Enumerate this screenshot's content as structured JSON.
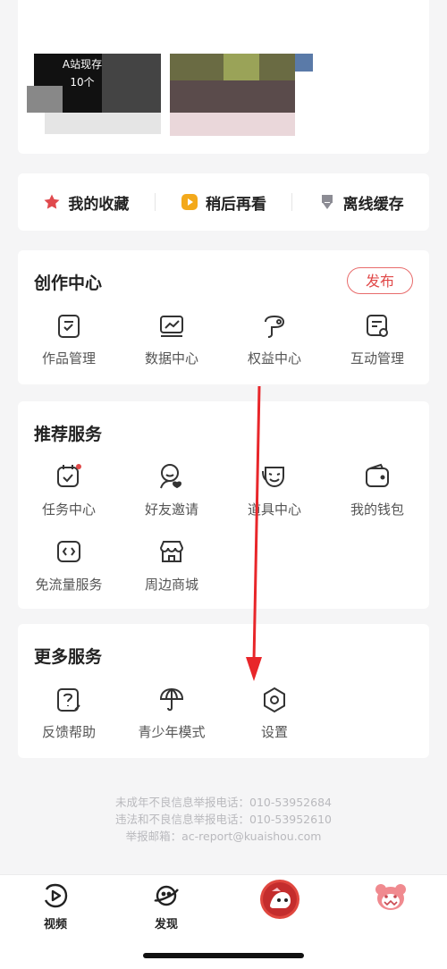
{
  "profile": {
    "line1": "A站现存",
    "line2": "10个"
  },
  "quick_actions": [
    {
      "label": "我的收藏",
      "icon": "star-icon"
    },
    {
      "label": "稍后再看",
      "icon": "play-later-icon"
    },
    {
      "label": "离线缓存",
      "icon": "download-icon"
    }
  ],
  "creation_center": {
    "title": "创作中心",
    "publish_label": "发布",
    "items": [
      {
        "label": "作品管理",
        "icon": "works-manage-icon"
      },
      {
        "label": "数据中心",
        "icon": "data-chart-icon"
      },
      {
        "label": "权益中心",
        "icon": "rights-icon"
      },
      {
        "label": "互动管理",
        "icon": "interaction-icon"
      }
    ]
  },
  "recommended": {
    "title": "推荐服务",
    "items": [
      {
        "label": "任务中心",
        "icon": "task-calendar-icon"
      },
      {
        "label": "好友邀请",
        "icon": "friend-invite-icon"
      },
      {
        "label": "道具中心",
        "icon": "mask-icon"
      },
      {
        "label": "我的钱包",
        "icon": "wallet-icon"
      },
      {
        "label": "免流量服务",
        "icon": "sim-card-icon"
      },
      {
        "label": "周边商城",
        "icon": "shop-icon"
      }
    ]
  },
  "more_services": {
    "title": "更多服务",
    "items": [
      {
        "label": "反馈帮助",
        "icon": "help-feedback-icon"
      },
      {
        "label": "青少年模式",
        "icon": "umbrella-icon"
      },
      {
        "label": "设置",
        "icon": "settings-hexagon-icon"
      }
    ]
  },
  "footer": {
    "line1": "未成年不良信息举报电话：010-53952684",
    "line2": "违法和不良信息举报电话：010-53952610",
    "line3": "举报邮箱：ac-report@kuaishou.com"
  },
  "tabbar": [
    {
      "label": "视频",
      "icon": "video-tab-icon"
    },
    {
      "label": "发现",
      "icon": "discover-planet-icon"
    },
    {
      "label": "",
      "icon": "center-mascot-icon"
    },
    {
      "label": "",
      "icon": "profile-bear-icon"
    }
  ],
  "colors": {
    "accent": "#e04848",
    "arrow": "#e8262a",
    "background": "#f5f5f6"
  }
}
